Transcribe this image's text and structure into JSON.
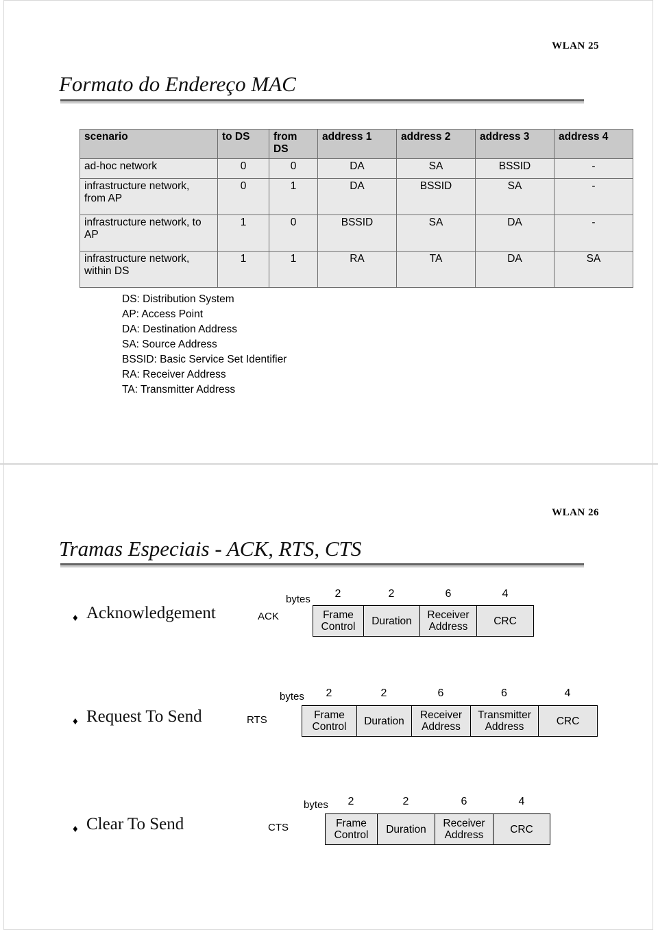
{
  "document": {
    "type": "lecture-slides-handout",
    "pages": 2
  },
  "slide1": {
    "slide_number_label": "WLAN  25",
    "title": "Formato do Endereço MAC",
    "table": {
      "headers": [
        "scenario",
        "to DS",
        "from DS",
        "address 1",
        "address 2",
        "address 3",
        "address 4"
      ],
      "rows": [
        {
          "scenario": "ad-hoc network",
          "to_ds": "0",
          "from_ds": "0",
          "address1": "DA",
          "address2": "SA",
          "address3": "BSSID",
          "address4": "-"
        },
        {
          "scenario": "infrastructure network, from AP",
          "to_ds": "0",
          "from_ds": "1",
          "address1": "DA",
          "address2": "BSSID",
          "address3": "SA",
          "address4": "-"
        },
        {
          "scenario": "infrastructure network, to AP",
          "to_ds": "1",
          "from_ds": "0",
          "address1": "BSSID",
          "address2": "SA",
          "address3": "DA",
          "address4": "-"
        },
        {
          "scenario": "infrastructure network, within DS",
          "to_ds": "1",
          "from_ds": "1",
          "address1": "RA",
          "address2": "TA",
          "address3": "DA",
          "address4": "SA"
        }
      ]
    },
    "legend": [
      "DS: Distribution System",
      "AP: Access Point",
      "DA: Destination Address",
      "SA: Source Address",
      "BSSID: Basic Service Set Identifier",
      "RA: Receiver Address",
      "TA: Transmitter Address"
    ]
  },
  "slide2": {
    "slide_number_label": "WLAN  26",
    "title": "Tramas Especiais - ACK, RTS, CTS",
    "bullet_glyph": "♦",
    "bytes_label": "bytes",
    "frames": [
      {
        "name": "Acknowledgement",
        "abbr": "ACK",
        "fields": [
          {
            "label": "Frame Control",
            "bytes": "2"
          },
          {
            "label": "Duration",
            "bytes": "2"
          },
          {
            "label": "Receiver Address",
            "bytes": "6"
          },
          {
            "label": "CRC",
            "bytes": "4"
          }
        ]
      },
      {
        "name": "Request To Send",
        "abbr": "RTS",
        "fields": [
          {
            "label": "Frame Control",
            "bytes": "2"
          },
          {
            "label": "Duration",
            "bytes": "2"
          },
          {
            "label": "Receiver Address",
            "bytes": "6"
          },
          {
            "label": "Transmitter Address",
            "bytes": "6"
          },
          {
            "label": "CRC",
            "bytes": "4"
          }
        ]
      },
      {
        "name": "Clear To Send",
        "abbr": "CTS",
        "fields": [
          {
            "label": "Frame Control",
            "bytes": "2"
          },
          {
            "label": "Duration",
            "bytes": "2"
          },
          {
            "label": "Receiver Address",
            "bytes": "6"
          },
          {
            "label": "CRC",
            "bytes": "4"
          }
        ]
      }
    ]
  },
  "colors": {
    "table_header_bg": "#c9c9c9",
    "table_cell_bg": "#e9e9e9",
    "frame_box_bg": "#e6e6e6",
    "rule_dark": "#4a4a4a",
    "page_border": "#d8d8d8"
  }
}
